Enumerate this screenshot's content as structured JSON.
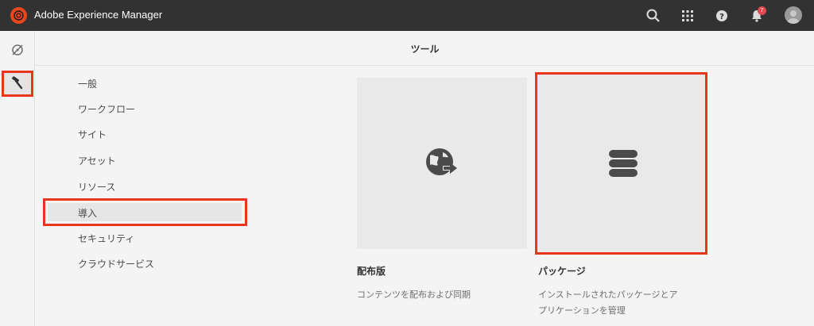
{
  "app": {
    "title": "Adobe Experience Manager",
    "notification_count": "7"
  },
  "header": {
    "title": "ツール"
  },
  "rail": {
    "items": [
      {
        "icon": "compass-icon"
      },
      {
        "icon": "hammer-icon",
        "selected": true
      }
    ]
  },
  "nav": {
    "items": [
      {
        "label": "一般"
      },
      {
        "label": "ワークフロー"
      },
      {
        "label": "サイト"
      },
      {
        "label": "アセット"
      },
      {
        "label": "リソース"
      },
      {
        "label": "導入",
        "selected": true
      },
      {
        "label": "セキュリティ"
      },
      {
        "label": "クラウドサービス"
      }
    ]
  },
  "cards": [
    {
      "icon": "globe-arrow-icon",
      "title": "配布版",
      "description": "コンテンツを配布および同期"
    },
    {
      "icon": "database-icon",
      "title": "パッケージ",
      "description_line1": "インストールされたパッケージとア",
      "description_line2": "プリケーションを管理"
    }
  ],
  "colors": {
    "topbar": "#323232",
    "accent": "#e8471e",
    "highlight": "#e8351e",
    "background": "#f4f4f4",
    "card": "#e9e9e9"
  }
}
